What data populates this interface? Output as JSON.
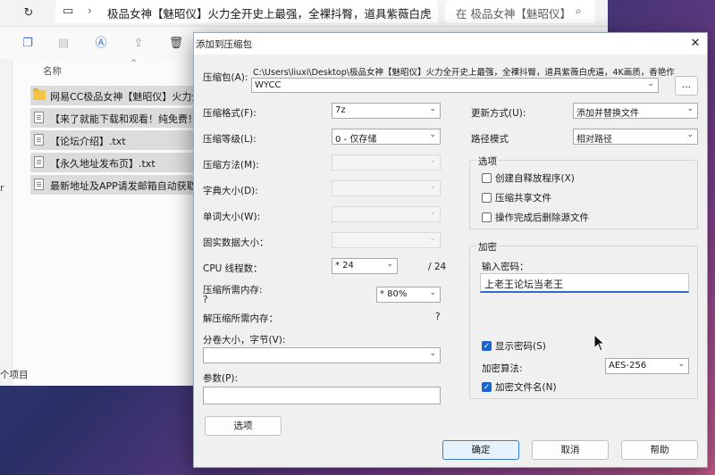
{
  "explorer": {
    "address_path": "极品女神【魅昭仪】火力全开史上最强，全裸抖臀，道具紫薇白虎",
    "search_placeholder": "在 极品女神【魅昭仪】",
    "column_name": "名称",
    "left_char": "r",
    "files": [
      {
        "name": "网易CC极品女神【魅昭仪】火力全",
        "type": "folder"
      },
      {
        "name": "【来了就能下载和观看！纯免费！】",
        "type": "file"
      },
      {
        "name": "【论坛介绍】.txt",
        "type": "file"
      },
      {
        "name": "【永久地址发布页】.txt",
        "type": "file"
      },
      {
        "name": "最新地址及APP请发邮箱自动获取!",
        "type": "file"
      }
    ],
    "status": "个项目"
  },
  "dialog": {
    "title": "添加到压缩包",
    "archive_label": "压缩包(A):",
    "archive_path": "C:\\Users\\liuxi\\Desktop\\极品女神【魅昭仪】火力全开史上最强，全裸抖臀，道具紫薇白虎逼，4K画质，香艳作",
    "archive_name": "WYCC",
    "browse_label": "...",
    "format_label": "压缩格式(F):",
    "format_value": "7z",
    "level_label": "压缩等级(L):",
    "level_value": "0 - 仅存储",
    "method_label": "压缩方法(M):",
    "dict_label": "字典大小(D):",
    "word_label": "单词大小(W):",
    "solid_label": "固实数据大小：",
    "cpu_label": "CPU 线程数：",
    "cpu_value": "* 24",
    "cpu_total": "/ 24",
    "mem_comp_label": "压缩所需内存:",
    "mem_comp_q": "?",
    "mem_comp_value": "* 80%",
    "mem_decomp_label": "解压缩所需内存：",
    "mem_decomp_q": "?",
    "volume_label": "分卷大小，字节(V):",
    "params_label": "参数(P):",
    "options_button": "选项",
    "update_label": "更新方式(U):",
    "update_value": "添加并替换文件",
    "pathmode_label": "路径模式",
    "pathmode_value": "相对路径",
    "options_group": "选项",
    "opt_sfx": "创建自释放程序(X)",
    "opt_shared": "压缩共享文件",
    "opt_delete": "操作完成后删除源文件",
    "encrypt_group": "加密",
    "password_label": "输入密码：",
    "password_value": "上老王论坛当老王",
    "show_pw": "显示密码(S)",
    "enc_method_label": "加密算法:",
    "enc_method_value": "AES-256",
    "enc_names": "加密文件名(N)",
    "ok": "确定",
    "cancel": "取消",
    "help": "帮助"
  }
}
